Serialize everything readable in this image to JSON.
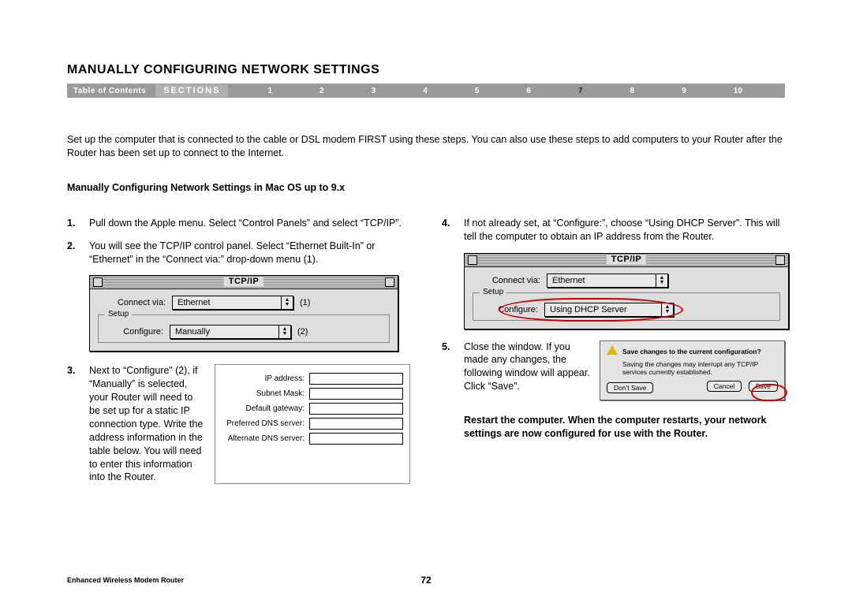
{
  "title": "MANUALLY CONFIGURING NETWORK SETTINGS",
  "nav": {
    "toc": "Table of Contents",
    "sections_label": "SECTIONS",
    "items": [
      "1",
      "2",
      "3",
      "4",
      "5",
      "6",
      "7",
      "8",
      "9",
      "10"
    ],
    "current": "7"
  },
  "intro": "Set up the computer that is connected to the cable or DSL modem FIRST using these steps. You can also use these steps to add computers to your Router after the Router has been set up to connect to the Internet.",
  "subhead": "Manually Configuring Network Settings in Mac OS up to 9.x",
  "left": {
    "step1": {
      "num": "1.",
      "text": "Pull down the Apple menu. Select “Control Panels” and select “TCP/IP”."
    },
    "step2": {
      "num": "2.",
      "text": "You will see the TCP/IP control panel. Select “Ethernet Built-In” or “Ethernet” in the “Connect via:” drop-down menu (1)."
    },
    "fig1": {
      "title": "TCP/IP",
      "connect_label": "Connect via:",
      "connect_value": "Ethernet",
      "setup_label": "Setup",
      "configure_label": "Configure:",
      "configure_value": "Manually",
      "callout1": "(1)",
      "callout2": "(2)"
    },
    "step3": {
      "num": "3.",
      "text": "Next to “Configure” (2), if “Manually” is selected, your Router will need to be set up for a static IP connection type. Write the address information in the table below. You will need to enter this information into the Router.",
      "fields": [
        "IP address:",
        "Subnet Mask:",
        "Default gateway:",
        "Preferred DNS server:",
        "Alternate DNS server:"
      ]
    }
  },
  "right": {
    "step4": {
      "num": "4.",
      "text": "If not already set, at “Configure:”, choose “Using DHCP Server”. This will tell the computer to obtain an IP address from the Router."
    },
    "fig2": {
      "title": "TCP/IP",
      "connect_label": "Connect via:",
      "connect_value": "Ethernet",
      "setup_label": "Setup",
      "configure_label": "Configure:",
      "configure_value": "Using DHCP Server"
    },
    "step5": {
      "num": "5.",
      "text": "Close the window. If you made any changes, the following window will appear. Click “Save”."
    },
    "dialog": {
      "msg1": "Save changes to the current configuration?",
      "msg2": "Saving the changes may interrupt any TCP/IP services currently established.",
      "dont_save": "Don't Save",
      "cancel": "Cancel",
      "save": "Save"
    },
    "restart": "Restart the computer. When the computer restarts, your network settings are now configured for use with the Router."
  },
  "footer": {
    "product": "Enhanced Wireless Modem Router",
    "page": "72"
  }
}
